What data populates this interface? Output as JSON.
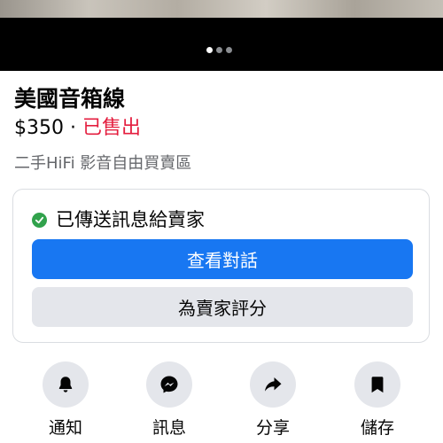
{
  "gallery": {
    "page_count": 3,
    "active_index": 0
  },
  "listing": {
    "title": "美國音箱線",
    "price": "$350",
    "separator": "·",
    "status": "已售出",
    "group": "二手HiFi 影音自由買賣區"
  },
  "message_card": {
    "sent_text": "已傳送訊息給賣家",
    "view_chat_label": "查看對話",
    "rate_seller_label": "為賣家評分"
  },
  "actions": [
    {
      "label": "通知",
      "icon": "bell-icon"
    },
    {
      "label": "訊息",
      "icon": "messenger-icon"
    },
    {
      "label": "分享",
      "icon": "share-arrow-icon"
    },
    {
      "label": "儲存",
      "icon": "bookmark-icon"
    }
  ],
  "colors": {
    "accent": "#1877f2",
    "sold": "#e41e3f",
    "success": "#31a24c",
    "secondary_bg": "#e4e6eb",
    "muted_text": "#65676b"
  }
}
